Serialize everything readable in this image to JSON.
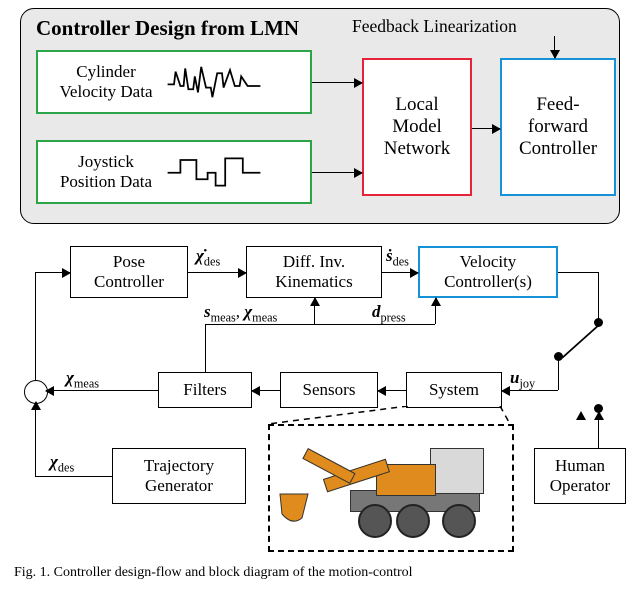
{
  "title": "Controller Design from LMN",
  "fbLinLabel": "Feedback Linearization",
  "inputs": {
    "cylVel": "Cylinder\nVelocity Data",
    "joyPos": "Joystick\nPosition Data"
  },
  "lmnBox": "Local\nModel\nNetwork",
  "ffBox": "Feed-\nforward\nController",
  "poseCtrl": "Pose\nController",
  "diffInvKin": "Diff. Inv.\nKinematics",
  "velCtrl": "Velocity\nController(s)",
  "filters": "Filters",
  "sensors": "Sensors",
  "system": "System",
  "trajGen": "Trajectory\nGenerator",
  "humanOp": "Human\nOperator",
  "signals": {
    "chiDotDes": {
      "base": "χ̇",
      "sub": "des"
    },
    "sDotDes": {
      "base": "ṡ",
      "sub": "des"
    },
    "sMeasChiMeas": {
      "left": {
        "base": "s",
        "sub": "meas"
      },
      "right": {
        "base": "χ",
        "sub": "meas"
      }
    },
    "dPress": {
      "base": "d",
      "sub": "press"
    },
    "uJoy": {
      "base": "u",
      "sub": "joy"
    },
    "chiMeas": {
      "base": "χ",
      "sub": "meas"
    },
    "chiDes": {
      "base": "χ",
      "sub": "des"
    }
  },
  "caption": "Fig. 1. Controller design-flow and block diagram of the motion-control"
}
